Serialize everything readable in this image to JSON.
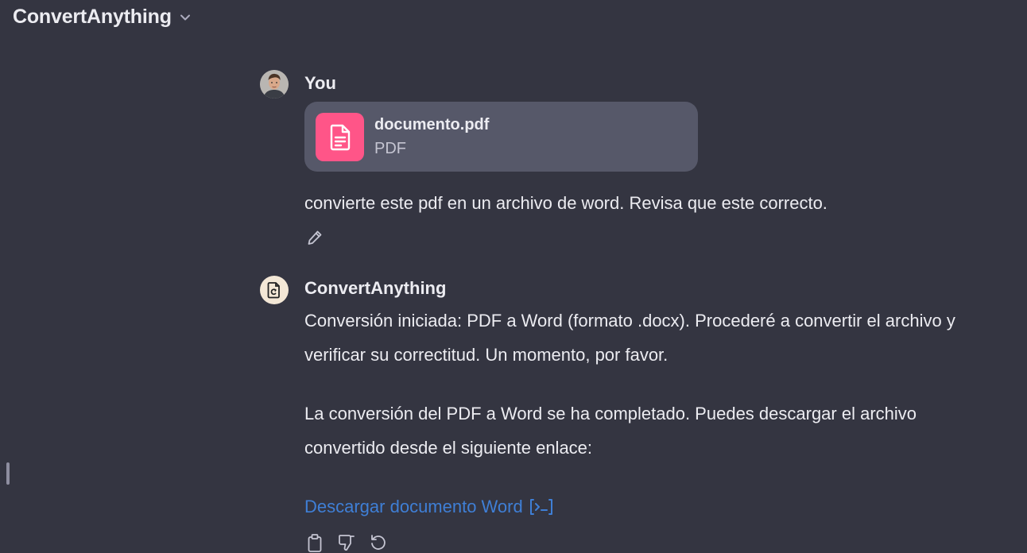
{
  "header": {
    "title": "ConvertAnything",
    "dropdown_icon": "chevron-down-icon"
  },
  "user_message": {
    "author": "You",
    "attachment": {
      "name": "documento.pdf",
      "type": "PDF",
      "icon": "document-icon",
      "color": "#ff5588"
    },
    "text": "convierte este pdf en un archivo de word. Revisa que este correcto.",
    "actions": [
      "edit-icon"
    ]
  },
  "assistant_message": {
    "author": "ConvertAnything",
    "paragraph1_line1": "Conversión iniciada: PDF a Word (formato .docx). Procederé a convertir el archivo y",
    "paragraph1_line2": "verificar su correctitud. Un momento, por favor.",
    "paragraph2_line1": "La conversión del PDF a Word se ha completado. Puedes descargar el archivo",
    "paragraph2_line2": "convertido desde el siguiente enlace:",
    "link_text": "Descargar documento Word",
    "link_color": "#3f7fd6",
    "actions": [
      "copy-icon",
      "thumbs-down-icon",
      "regenerate-icon"
    ]
  },
  "colors": {
    "background": "#343541",
    "card": "#565869",
    "text": "#ececf1"
  }
}
